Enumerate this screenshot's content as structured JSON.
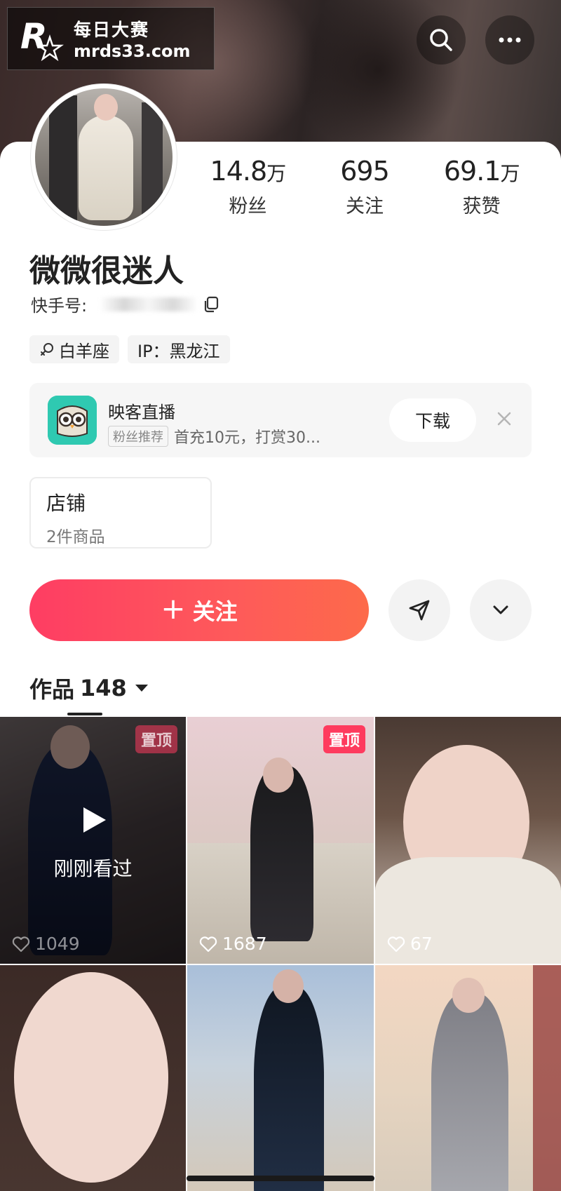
{
  "watermark": {
    "site_name": "每日大赛",
    "url": "mrds33.com"
  },
  "icons": {
    "search": "search-icon",
    "more": "more-dots-icon",
    "copy": "copy-icon",
    "zodiac": "zodiac-aries-icon",
    "close": "close-icon",
    "share": "send-icon",
    "expand": "chevron-down-icon",
    "play": "play-icon",
    "like": "heart-icon"
  },
  "profile": {
    "stats": [
      {
        "value": "14.8",
        "unit": "万",
        "label": "粉丝"
      },
      {
        "value": "695",
        "unit": "",
        "label": "关注"
      },
      {
        "value": "69.1",
        "unit": "万",
        "label": "获赞"
      }
    ],
    "name": "微微很迷人",
    "id_label": "快手号:",
    "tags": {
      "zodiac": "白羊座",
      "ip": "IP：黑龙江"
    }
  },
  "ad": {
    "title": "映客直播",
    "badge": "粉丝推荐",
    "subtitle": "首充10元，打赏30...",
    "download_label": "下载"
  },
  "shop": {
    "title": "店铺",
    "subtitle": "2件商品"
  },
  "actions": {
    "follow_label": "关注"
  },
  "works": {
    "label": "作品",
    "count": "148"
  },
  "grid": [
    {
      "pin": "置顶",
      "likes": "1049",
      "watched": "刚刚看过"
    },
    {
      "pin": "置顶",
      "likes": "1687"
    },
    {
      "likes": "67"
    },
    {},
    {},
    {}
  ],
  "colors": {
    "accent": "#fe3d63",
    "accent_end": "#fd6a4a",
    "ad_icon": "#2fc9b1"
  }
}
